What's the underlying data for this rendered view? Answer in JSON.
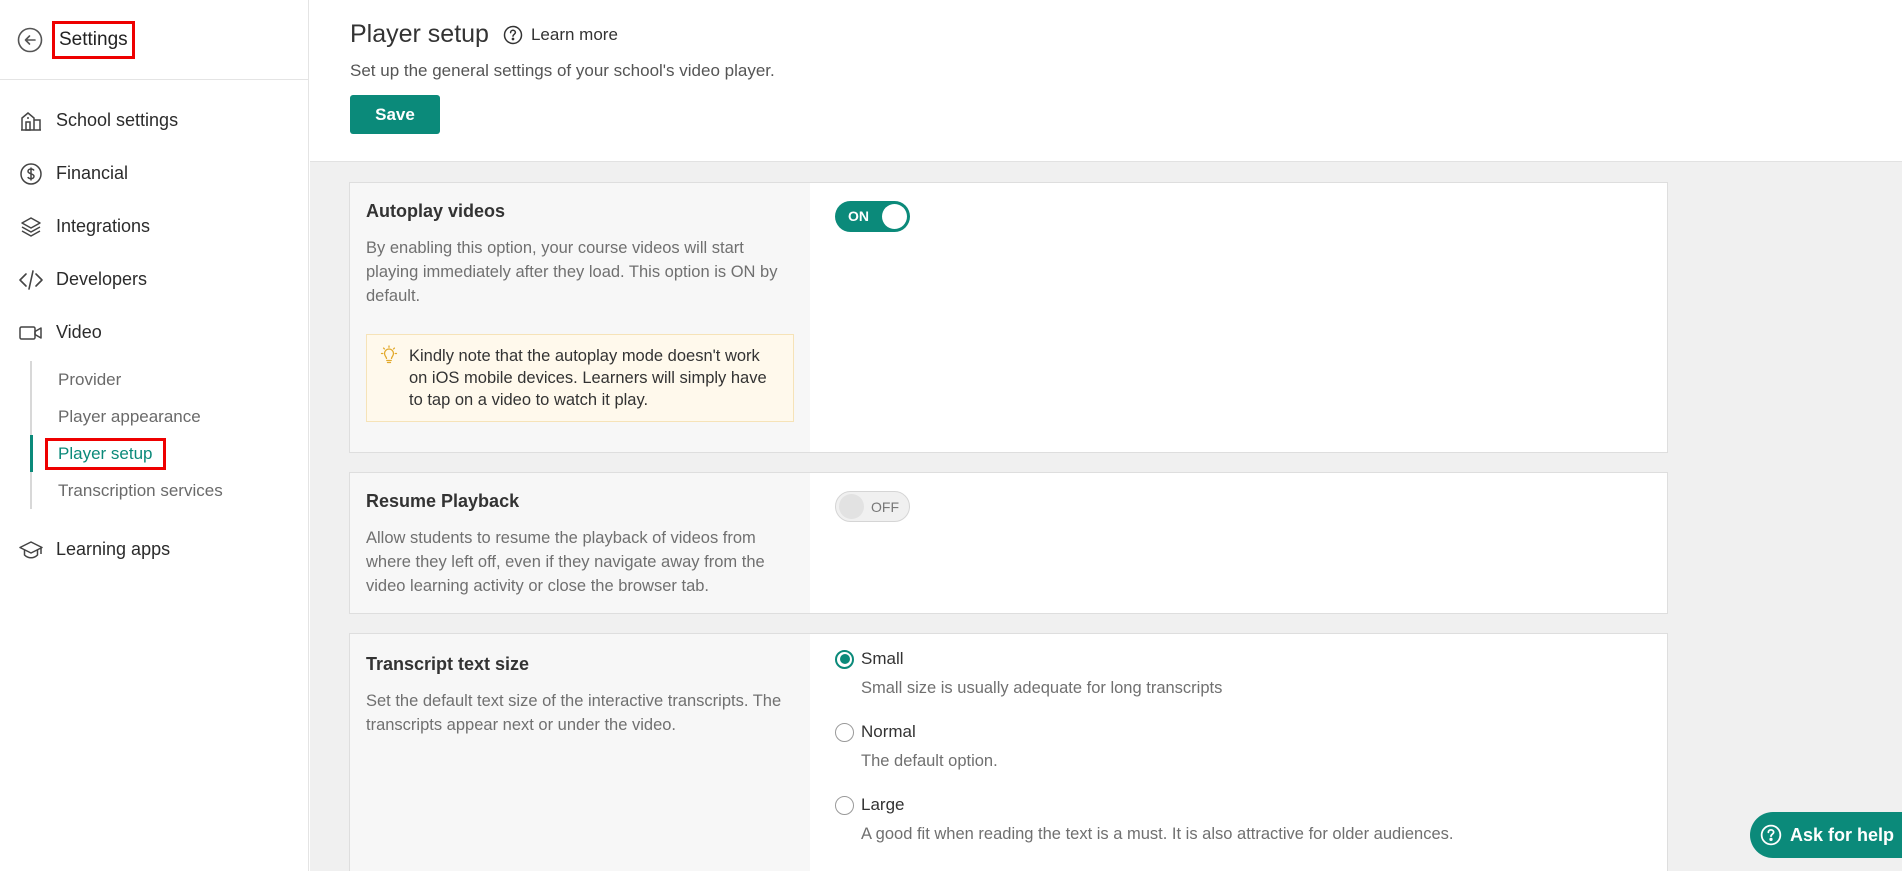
{
  "sidebar": {
    "title": "Settings",
    "items": [
      {
        "label": "School settings",
        "icon": "building-icon"
      },
      {
        "label": "Financial",
        "icon": "dollar-circle-icon"
      },
      {
        "label": "Integrations",
        "icon": "layers-icon"
      },
      {
        "label": "Developers",
        "icon": "code-icon"
      },
      {
        "label": "Video",
        "icon": "video-camera-icon"
      }
    ],
    "video_subitems": [
      {
        "label": "Provider"
      },
      {
        "label": "Player appearance"
      },
      {
        "label": "Player setup"
      },
      {
        "label": "Transcription services"
      }
    ],
    "learning_apps": {
      "label": "Learning apps",
      "icon": "graduation-cap-icon"
    }
  },
  "header": {
    "title": "Player setup",
    "learn_more": "Learn more",
    "description": "Set up the general settings of your school's video player.",
    "save_label": "Save"
  },
  "autoplay": {
    "title": "Autoplay videos",
    "description": "By enabling this option, your course videos will start playing immediately after they load. This option is ON by default.",
    "note": "Kindly note that the autoplay mode doesn't work on iOS mobile devices. Learners will simply have to tap on a video to watch it play.",
    "toggle_label": "ON",
    "enabled": true
  },
  "resume": {
    "title": "Resume Playback",
    "description": "Allow students to resume the playback of videos from where they left off, even if they navigate away from the video learning activity or close the browser tab.",
    "toggle_label": "OFF",
    "enabled": false
  },
  "transcript": {
    "title": "Transcript text size",
    "description": "Set the default text size of the interactive transcripts. The transcripts appear next or under the video.",
    "options": [
      {
        "label": "Small",
        "help": "Small size is usually adequate for long transcripts",
        "checked": true
      },
      {
        "label": "Normal",
        "help": "The default option.",
        "checked": false
      },
      {
        "label": "Large",
        "help": "A good fit when reading the text is a must. It is also attractive for older audiences.",
        "checked": false
      }
    ]
  },
  "help_button": {
    "label": "Ask for help"
  },
  "colors": {
    "accent": "#0b8a7a",
    "highlight_box": "#ee0000"
  }
}
